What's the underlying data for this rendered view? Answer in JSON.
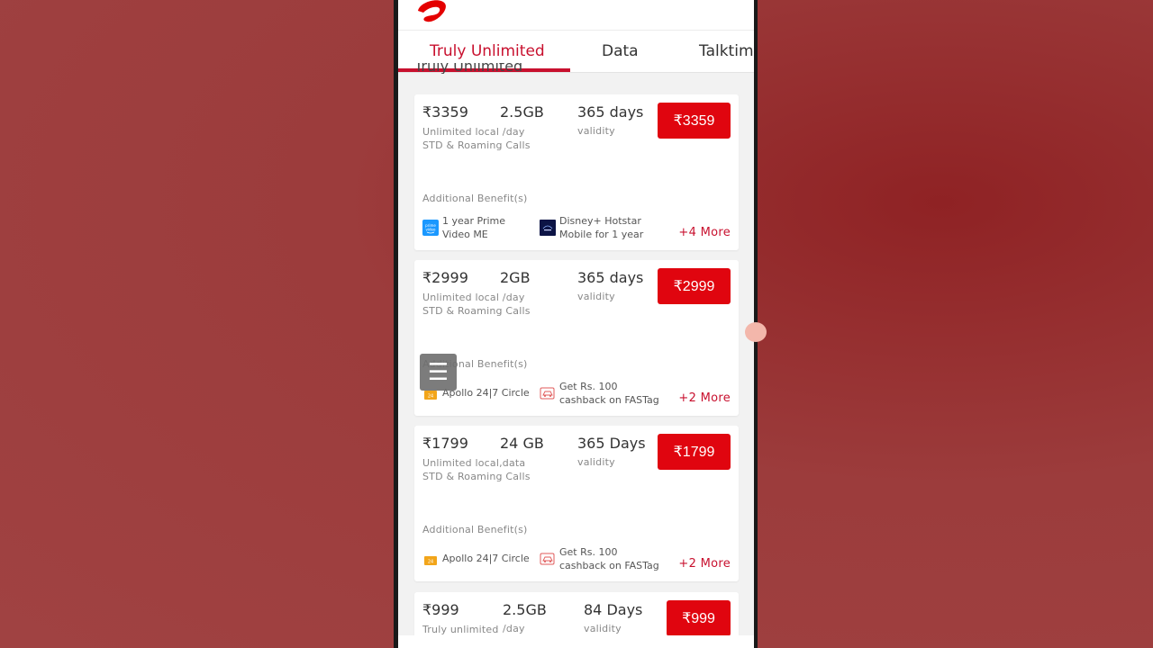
{
  "tabs": [
    {
      "label": "Truly Unlimited",
      "active": true
    },
    {
      "label": "Data",
      "active": false
    },
    {
      "label": "Talktime",
      "active": false
    }
  ],
  "section_title": "Truly Unlimited",
  "plans": [
    {
      "price": "₹3359",
      "data": "2.5GB",
      "validity": "365 days",
      "validity_label": "validity",
      "desc": "Unlimited local /day STD & Roaming Calls",
      "cta": "₹3359",
      "addl_label": "Additional Benefit(s)",
      "benefits": [
        {
          "icon": "prime-video-icon",
          "text": "1 year Prime Video ME"
        },
        {
          "icon": "disney-hotstar-icon",
          "text": "Disney+ Hotstar Mobile for 1 year"
        }
      ],
      "more": "+4 More"
    },
    {
      "price": "₹2999",
      "data": "2GB",
      "validity": "365 days",
      "validity_label": "validity",
      "desc": "Unlimited local /day STD & Roaming Calls",
      "cta": "₹2999",
      "addl_label": "Additional Benefit(s)",
      "benefits": [
        {
          "icon": "apollo-icon",
          "text": "Apollo 24|7 Circle"
        },
        {
          "icon": "fastag-car-icon",
          "text": "Get Rs. 100 cashback on FASTag"
        }
      ],
      "more": "+2 More"
    },
    {
      "price": "₹1799",
      "data": "24 GB",
      "validity": "365 Days",
      "validity_label": "validity",
      "desc": "Unlimited local,data STD & Roaming Calls",
      "cta": "₹1799",
      "addl_label": "Additional Benefit(s)",
      "benefits": [
        {
          "icon": "apollo-icon",
          "text": "Apollo 24|7 Circle"
        },
        {
          "icon": "fastag-car-icon",
          "text": "Get Rs. 100 cashback on FASTag"
        }
      ],
      "more": "+2 More"
    },
    {
      "price": "₹999",
      "data": "2.5GB",
      "validity": "84 Days",
      "validity_label": "validity",
      "desc": "Truly unlimited",
      "data_sub": "/day",
      "cta": "₹999"
    }
  ],
  "fab": {
    "icon": "menu-icon",
    "glyph": "☰"
  },
  "colors": {
    "brand_red": "#e0050f",
    "tab_active": "#c8102e",
    "background": "#a04242"
  }
}
